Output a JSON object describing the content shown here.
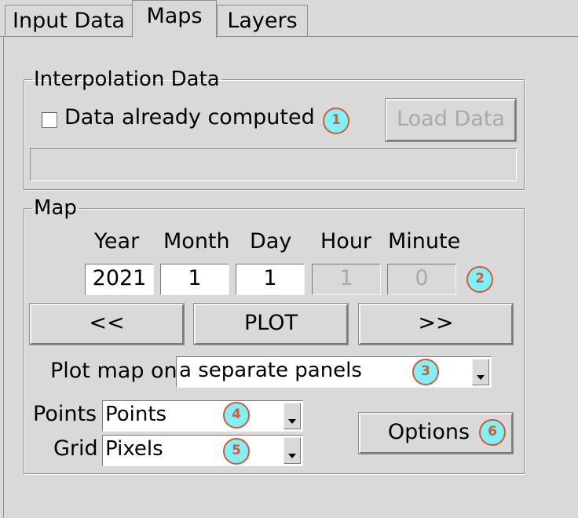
{
  "tabs": [
    {
      "label": "Input Data",
      "active": false
    },
    {
      "label": "Maps",
      "active": true
    },
    {
      "label": "Layers",
      "active": false
    }
  ],
  "interpolation": {
    "legend": "Interpolation Data",
    "checkbox_label": "Data already computed",
    "checkbox_checked": false,
    "load_button": "Load Data",
    "status_text": ""
  },
  "map": {
    "legend": "Map",
    "headers": {
      "year": "Year",
      "month": "Month",
      "day": "Day",
      "hour": "Hour",
      "minute": "Minute"
    },
    "values": {
      "year": "2021",
      "month": "1",
      "day": "1",
      "hour": "1",
      "minute": "0"
    },
    "prev_button": "<<",
    "plot_button": "PLOT",
    "next_button": ">>",
    "plot_on_label": "Plot map on",
    "plot_on_value": "a separate panels",
    "points_label": "Points",
    "points_value": "Points",
    "grid_label": "Grid",
    "grid_value": "Pixels",
    "options_button": "Options"
  },
  "markers": [
    "1",
    "2",
    "3",
    "4",
    "5",
    "6"
  ],
  "colors": {
    "background": "#d9d9d9",
    "marker_fill": "#7ff0ff",
    "marker_border": "#d9582e"
  }
}
